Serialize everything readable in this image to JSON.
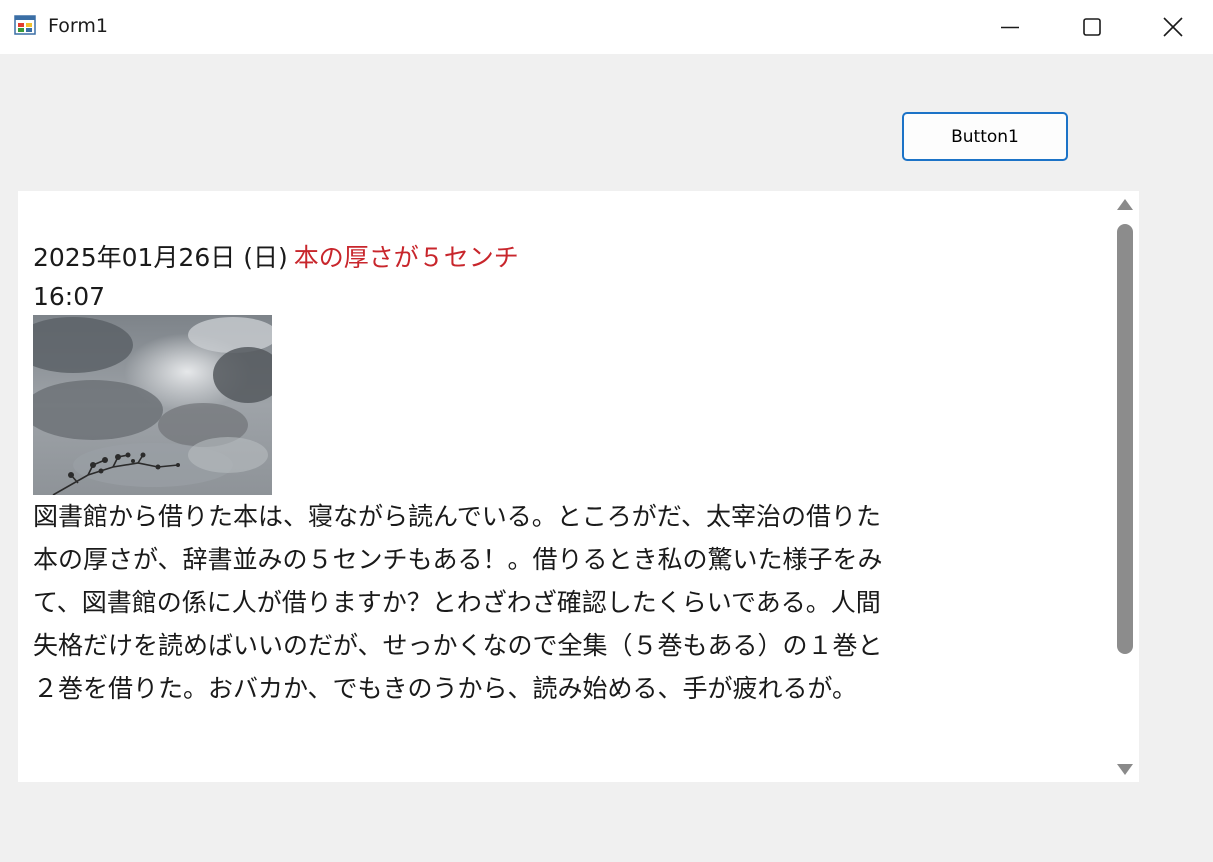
{
  "window": {
    "title": "Form1",
    "icon": "winforms-app-icon",
    "controls": {
      "minimize": "minimize-icon",
      "maximize": "maximize-icon",
      "close": "close-icon"
    }
  },
  "button1": {
    "label": "Button1"
  },
  "post": {
    "date": "2025年01月26日 (日)",
    "headline": "本の厚さが５センチ",
    "time": "16:07",
    "photo": "cloudy-sky-photo",
    "body": "図書館から借りた本は、寝ながら読んでいる。ところがだ、太宰治の借りた本の厚さが、辞書並みの５センチもある！。借りるとき私の驚いた様子をみて、図書館の係に人が借りますか？とわざわざ確認したくらいである。人間失格だけを読めばいいのだが、せっかくなので全集（５巻もある）の１巻と２巻を借りた。おバカか、でもきのうから、読み始める、手が疲れるが。"
  },
  "colors": {
    "headline": "#c8262c",
    "button_border": "#1c73c7",
    "window_bg": "#f0f0f0"
  }
}
